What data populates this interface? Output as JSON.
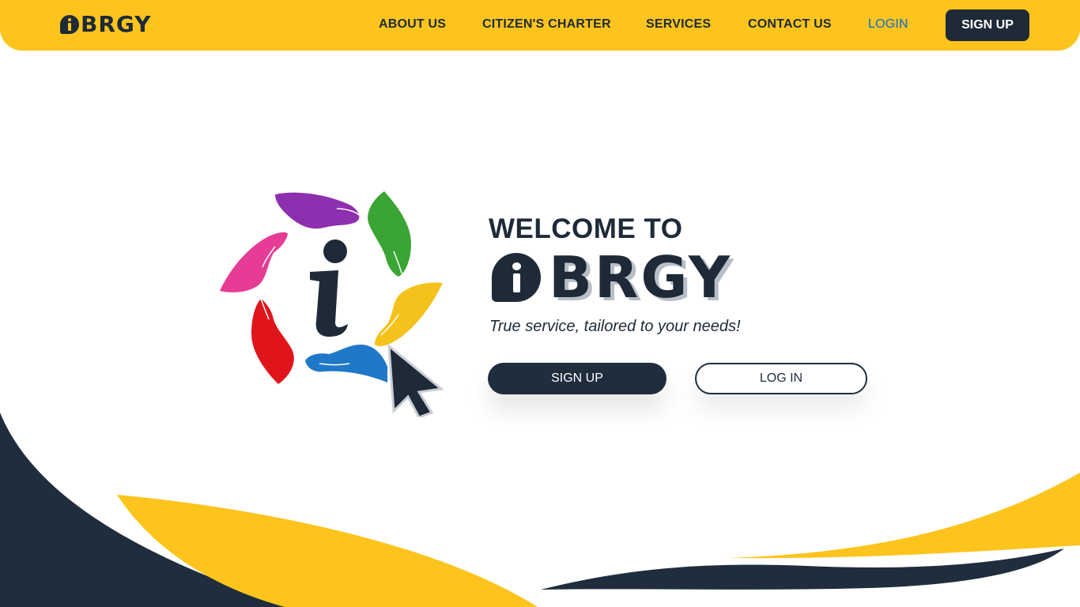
{
  "header": {
    "brand": "BRGY",
    "nav": [
      {
        "label": "ABOUT US"
      },
      {
        "label": "CITIZEN'S CHARTER"
      },
      {
        "label": "SERVICES"
      },
      {
        "label": "CONTACT US"
      },
      {
        "label": "LOGIN"
      }
    ],
    "signup_label": "SIGN UP"
  },
  "hero": {
    "welcome": "WELCOME TO",
    "brand": "BRGY",
    "tagline": "True service, tailored to your needs!",
    "signup_label": "SIGN UP",
    "login_label": "LOG IN"
  },
  "colors": {
    "brand_yellow": "#fcc41c",
    "navy": "#1e2a38",
    "login_link": "#2f78b5"
  },
  "icons": [
    "brgy-logo-icon",
    "hands-logo-icon",
    "cursor-icon"
  ]
}
